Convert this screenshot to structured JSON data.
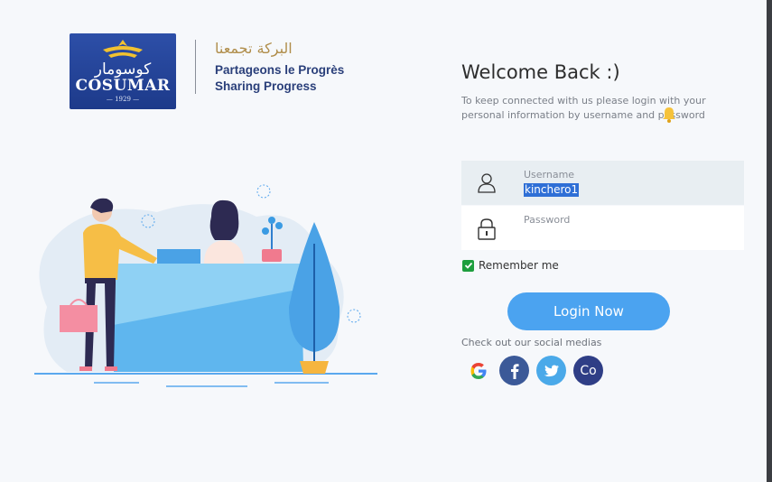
{
  "brand": {
    "arabic_name": "كوسومار",
    "name": "COSUMAR",
    "year": "— 1929 —",
    "slogan_ar": "البركة تجمعنا",
    "slogan_fr": "Partageons le Progrès",
    "slogan_en": "Sharing Progress"
  },
  "form": {
    "title": "Welcome Back :)",
    "info": "To keep connected with us please login with your personal information by username and password",
    "username_label": "Username",
    "username_value": "kinchero1",
    "password_label": "Password",
    "remember_label": "Remember me",
    "remember_checked": true,
    "login_button": "Login Now",
    "social_label": "Check out our social medias",
    "social_co_label": "Co"
  },
  "icons": {
    "bell": "bell-icon",
    "user": "user-icon",
    "lock": "lock-icon",
    "google": "google-icon",
    "facebook": "facebook-icon",
    "twitter": "twitter-icon"
  },
  "colors": {
    "brand_blue": "#1d3a8a",
    "brand_gold": "#b08d4a",
    "accent": "#4ba3f0",
    "check_green": "#1e9e3e",
    "facebook": "#3b5998",
    "twitter": "#4aa9e9",
    "co": "#2f3e86"
  }
}
